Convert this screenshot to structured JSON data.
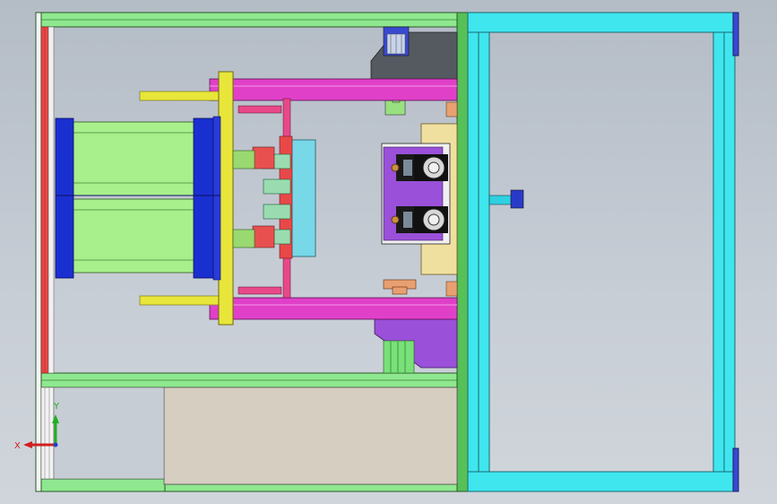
{
  "viewport": {
    "background_top": "#b4bcc6",
    "background_bottom": "#d0d5db"
  },
  "colors": {
    "frame_green": "#8fe88f",
    "frame_outline": "#2a5a2a",
    "cyan_frame": "#3fe6ee",
    "cylinder_green": "#a8f08c",
    "cylinder_cap_blue": "#1a2fd0",
    "yellow_plate": "#e8e63a",
    "magenta_rod": "#e040c8",
    "red_post": "#e84848",
    "light_blue_plate": "#78d8e8",
    "purple_block": "#9a50d8",
    "tan_block": "#f0e0a0",
    "dark_grey_block": "#555a60",
    "base_panel": "#d6cec0",
    "orange_clamp": "#e8a070"
  },
  "triad": {
    "x_label": "X",
    "y_label": "Y",
    "x_color": "#d02020",
    "y_color": "#20b020"
  }
}
